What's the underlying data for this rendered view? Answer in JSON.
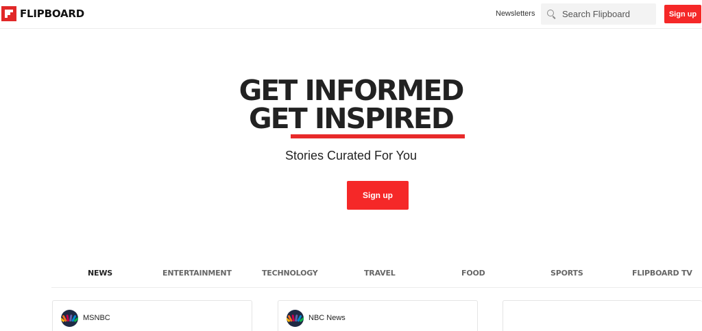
{
  "header": {
    "logo_text": "FLIPBOARD",
    "newsletters_label": "Newsletters",
    "search_placeholder": "Search Flipboard",
    "signup_label": "Sign up"
  },
  "hero": {
    "line1": "GET INFORMED",
    "line2": "GET INSPIRED",
    "subtitle": "Stories Curated For You",
    "signup_label": "Sign up"
  },
  "tabs": [
    {
      "label": "NEWS",
      "active": true
    },
    {
      "label": "ENTERTAINMENT",
      "active": false
    },
    {
      "label": "TECHNOLOGY",
      "active": false
    },
    {
      "label": "TRAVEL",
      "active": false
    },
    {
      "label": "FOOD",
      "active": false
    },
    {
      "label": "SPORTS",
      "active": false
    },
    {
      "label": "FLIPBOARD TV",
      "active": false
    }
  ],
  "cards": [
    {
      "source": "MSNBC",
      "icon": "nbc-peacock-icon"
    },
    {
      "source": "NBC News",
      "icon": "nbc-peacock-icon"
    },
    {
      "source": "",
      "icon": ""
    }
  ],
  "colors": {
    "brand_red": "#f52828",
    "underline_red": "#e82a2a"
  }
}
